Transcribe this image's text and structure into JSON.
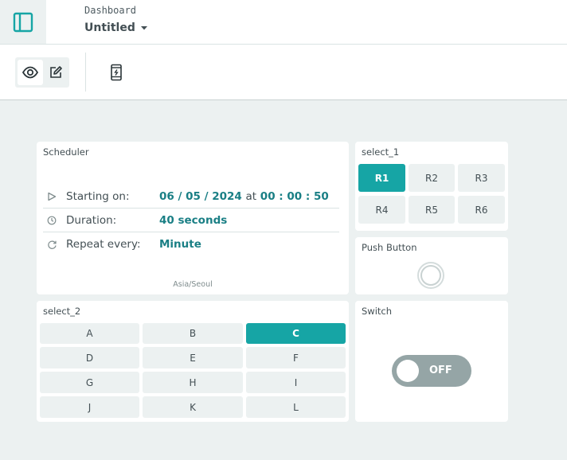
{
  "header": {
    "breadcrumb": "Dashboard",
    "title": "Untitled",
    "sidebar_toggle_icon": "sidebar-panel-icon",
    "dropdown_icon": "caret-down-icon"
  },
  "toolbar": {
    "view_icon": "eye-icon",
    "edit_icon": "pencil-icon",
    "mobile_icon": "mobile-phone-icon"
  },
  "colors": {
    "accent": "#16a5a5",
    "value_text": "#1a7f85",
    "background": "#ecf1f1",
    "switch_off": "#95a5a6"
  },
  "scheduler": {
    "title": "Scheduler",
    "rows": [
      {
        "icon": "play-icon",
        "label": "Starting on:",
        "date": "06 / 05 / 2024",
        "at": "at",
        "time": "00 : 00 : 50"
      },
      {
        "icon": "clock-icon",
        "label": "Duration:",
        "value": "40 seconds"
      },
      {
        "icon": "repeat-icon",
        "label": "Repeat every:",
        "value": "Minute"
      }
    ],
    "timezone": "Asia/Seoul"
  },
  "select_1": {
    "title": "select_1",
    "options": [
      "R1",
      "R2",
      "R3",
      "R4",
      "R5",
      "R6"
    ],
    "selected": "R1"
  },
  "push_button": {
    "title": "Push Button"
  },
  "select_2": {
    "title": "select_2",
    "options": [
      "A",
      "B",
      "C",
      "D",
      "E",
      "F",
      "G",
      "H",
      "I",
      "J",
      "K",
      "L"
    ],
    "selected": "C"
  },
  "switch": {
    "title": "Switch",
    "state": "OFF"
  }
}
